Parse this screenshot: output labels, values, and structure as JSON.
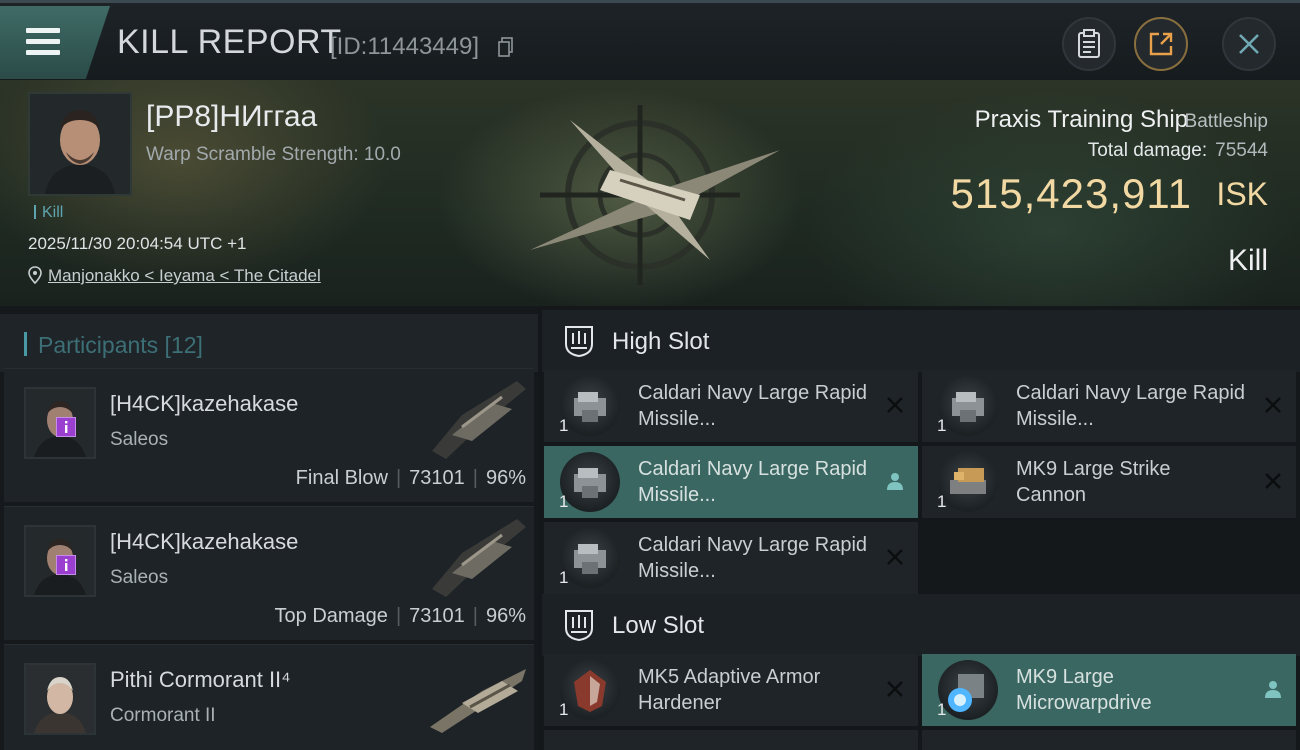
{
  "header": {
    "title": "KILL REPORT",
    "id_text": "[ID:11443449]"
  },
  "victim": {
    "name": "[PP8]НИггаа",
    "warp_scramble": "Warp Scramble Strength: 10.0",
    "kill_tag": "Kill",
    "timestamp": "2025/11/30 20:04:54 UTC +1",
    "location": "Manjonakko < Ieyama < The Citadel",
    "ship_name": "Praxis Training Ship",
    "ship_class": "Battleship",
    "total_damage_label": "Total damage:",
    "total_damage_value": "75544",
    "isk_value": "515,423,911",
    "isk_unit": "ISK",
    "result": "Kill"
  },
  "participants": {
    "label": "Participants [12]",
    "rows": [
      {
        "name": "[H4CK]kazehakase",
        "ship": "Saleos",
        "role": "Final Blow",
        "damage": "73101",
        "percent": "96%"
      },
      {
        "name": "[H4CK]kazehakase",
        "ship": "Saleos",
        "role": "Top Damage",
        "damage": "73101",
        "percent": "96%"
      },
      {
        "name": "Pithi Cormorant II⁴",
        "ship": "Cormorant II",
        "role": "",
        "damage": "",
        "percent": ""
      }
    ]
  },
  "fitting": {
    "high_slot_title": "High Slot",
    "low_slot_title": "Low Slot",
    "high_slot": [
      {
        "name": "Caldari Navy Large Rapid Missile...",
        "qty": "1",
        "status": "destroyed"
      },
      {
        "name": "Caldari Navy Large Rapid Missile...",
        "qty": "1",
        "status": "destroyed"
      },
      {
        "name": "Caldari Navy Large Rapid Missile...",
        "qty": "1",
        "status": "dropped"
      },
      {
        "name": "MK9 Large Strike Cannon",
        "qty": "1",
        "status": "destroyed"
      },
      {
        "name": "Caldari Navy Large Rapid Missile...",
        "qty": "1",
        "status": "destroyed"
      }
    ],
    "low_slot": [
      {
        "name": "MK5 Adaptive Armor Hardener",
        "qty": "1",
        "status": "destroyed"
      },
      {
        "name": "MK9 Large Microwarpdrive",
        "qty": "1",
        "status": "dropped"
      }
    ]
  },
  "colors": {
    "accent": "#4a9aa6",
    "isk": "#f2d9a3",
    "dropped_highlight": "#3b6763",
    "badge_purple": "#9b3fd0"
  }
}
